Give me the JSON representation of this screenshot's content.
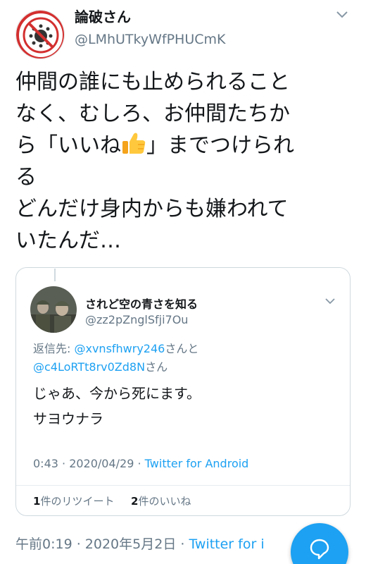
{
  "tweet": {
    "display_name": "論破さん",
    "handle": "@LMhUTkyWfPHUCmK",
    "text_lines": [
      "仲間の誰にも止められること",
      "なく、むしろ、お仲間たちか",
      "ら「いいね",
      "」までつけられ",
      "る",
      "どんだけ身内からも嫌われて",
      "いたんだ…"
    ],
    "avatar_text": "STOP CORONAVIRUS",
    "timestamp": "午前0:19 · 2020年5月2日 · ",
    "via": "Twitter for i"
  },
  "quote": {
    "display_name": "されど空の青さを知る",
    "handle": "@zz2pZnglSfji7Ou",
    "reply_prefix": "返信先: ",
    "mention1": "@xvnsfhwry246",
    "mention1_suffix": "さんと",
    "mention2": "@c4LoRTt8rv0Zd8N",
    "mention2_suffix": "さん",
    "body_lines": [
      "じゃあ、今から死にます。",
      "サヨウナラ"
    ],
    "meta_time": "0:43 · 2020/04/29 · ",
    "meta_via": "Twitter for Android",
    "retweets_count": "1",
    "retweets_label": "件のリツイート",
    "likes_count": "2",
    "likes_label": "件のいいね"
  },
  "colors": {
    "accent": "#1da1f2",
    "muted": "#657786",
    "text": "#14171a",
    "border": "#cfd9de"
  },
  "icons": {
    "fab": "reply-bubble-icon",
    "thumb": "thumbs-up-icon"
  }
}
